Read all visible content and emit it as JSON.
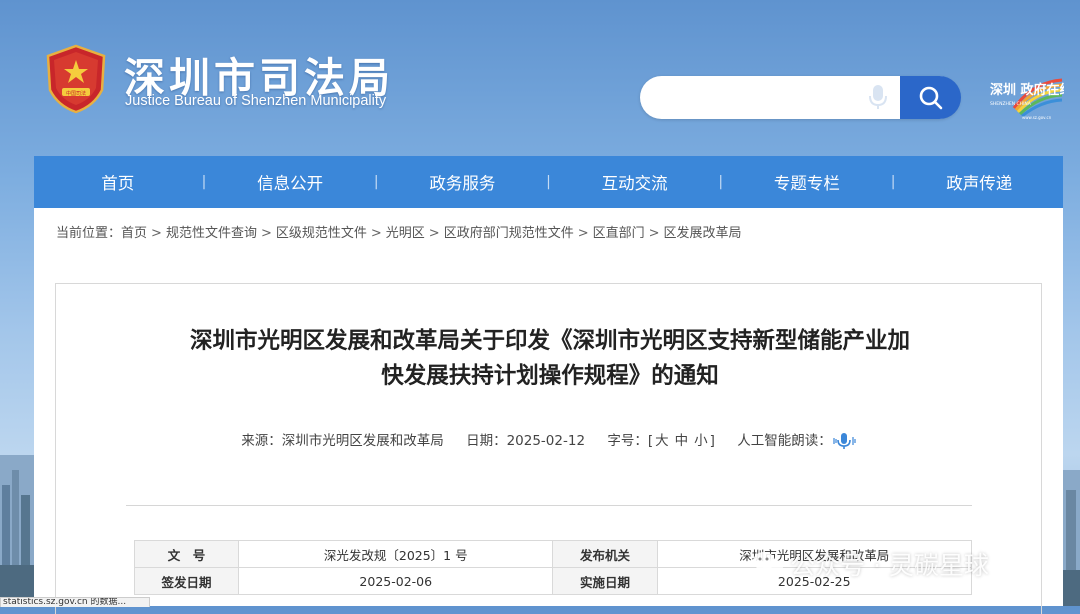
{
  "header": {
    "title": "深圳市司法局",
    "subtitle": "Justice Bureau of Shenzhen Municipality",
    "emblem_label": "中国司法",
    "search_placeholder": "",
    "logo_text": "深圳 政府在线",
    "logo_subtext": "SHENZHEN CHINA",
    "logo_url": "www.sz.gov.cn"
  },
  "nav": {
    "items": [
      "首页",
      "信息公开",
      "政务服务",
      "互动交流",
      "专题专栏",
      "政声传递"
    ],
    "separator": "|"
  },
  "breadcrumb": {
    "prefix": "当前位置：",
    "items": [
      "首页",
      "规范性文件查询",
      "区级规范性文件",
      "光明区",
      "区政府部门规范性文件",
      "区直部门",
      "区发展改革局"
    ],
    "separator": ">"
  },
  "article": {
    "title_line1": "深圳市光明区发展和改革局关于印发《深圳市光明区支持新型储能产业加",
    "title_line2": "快发展扶持计划操作规程》的通知",
    "source_label": "来源：",
    "source": "深圳市光明区发展和改革局",
    "date_label": "日期：",
    "date": "2025-02-12",
    "fontsize_label": "字号：",
    "fontsize_open": "[",
    "fontsize_large": "大",
    "fontsize_medium": "中",
    "fontsize_small": "小",
    "fontsize_close": "]",
    "ai_read_label": "人工智能朗读："
  },
  "info_table": {
    "doc_no_label": "文　号",
    "doc_no": "深光发改规〔2025〕1 号",
    "issuer_label": "发布机关",
    "issuer": "深圳市光明区发展和改革局",
    "sign_date_label": "签发日期",
    "sign_date": "2025-02-06",
    "effective_date_label": "实施日期",
    "effective_date": "2025-02-25"
  },
  "watermark": {
    "text": "公众号 · 灵碳星球"
  },
  "status_bar": {
    "text": "statistics.sz.gov.cn 的数据..."
  },
  "colors": {
    "nav_bg": "#3b87d9",
    "search_button": "#2b67c9",
    "title_text": "#222222"
  },
  "icons": [
    "emblem-icon",
    "microphone-icon",
    "search-icon",
    "speaker-icon",
    "wechat-icon"
  ]
}
